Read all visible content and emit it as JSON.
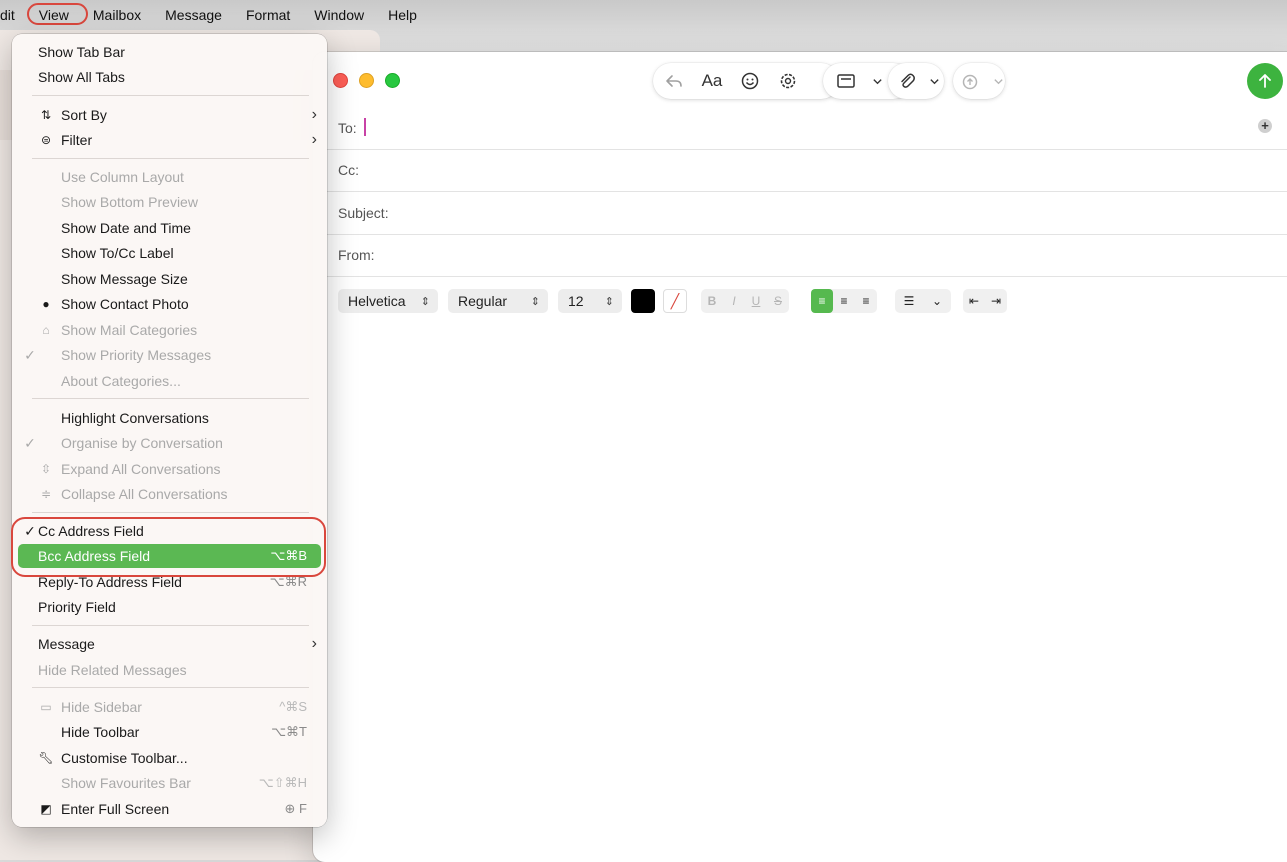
{
  "menubar": {
    "items": [
      "dit",
      "View",
      "Mailbox",
      "Message",
      "Format",
      "Window",
      "Help"
    ]
  },
  "menu": {
    "tab_bar": "Show Tab Bar",
    "all_tabs": "Show All Tabs",
    "sort_by": "Sort By",
    "filter": "Filter",
    "column_layout": "Use Column Layout",
    "bottom_preview": "Show Bottom Preview",
    "date_time": "Show Date and Time",
    "tocc_label": "Show To/Cc Label",
    "message_size": "Show Message Size",
    "contact_photo": "Show Contact Photo",
    "mail_categories": "Show Mail Categories",
    "priority_messages": "Show Priority Messages",
    "about_categories": "About Categories...",
    "highlight_conv": "Highlight Conversations",
    "organise_conv": "Organise by Conversation",
    "expand_conv": "Expand All Conversations",
    "collapse_conv": "Collapse All Conversations",
    "cc_field": "Cc Address Field",
    "bcc_field": "Bcc Address Field",
    "bcc_shortcut": "⌥⌘B",
    "replyto_field": "Reply-To Address Field",
    "replyto_shortcut": "⌥⌘R",
    "priority_field": "Priority Field",
    "message": "Message",
    "hide_related": "Hide Related Messages",
    "hide_sidebar": "Hide Sidebar",
    "hide_sidebar_sc": "^⌘S",
    "hide_toolbar": "Hide Toolbar",
    "hide_toolbar_sc": "⌥⌘T",
    "customise_toolbar": "Customise Toolbar...",
    "fav_bar": "Show Favourites Bar",
    "fav_bar_sc": "⌥⇧⌘H",
    "full_screen": "Enter Full Screen",
    "full_screen_sc": "F",
    "check_mark": "✓"
  },
  "compose": {
    "to_label": "To:",
    "cc_label": "Cc:",
    "subject_label": "Subject:",
    "from_label": "From:",
    "font_label": "Aa",
    "format": {
      "font": "Helvetica",
      "style": "Regular",
      "size": "12",
      "bold": "B",
      "italic": "I",
      "underline": "U",
      "strike": "S"
    }
  },
  "colors": {
    "highlight": "#5bb853",
    "annotation_ring": "#d9473d",
    "send_button": "#3db33f"
  }
}
